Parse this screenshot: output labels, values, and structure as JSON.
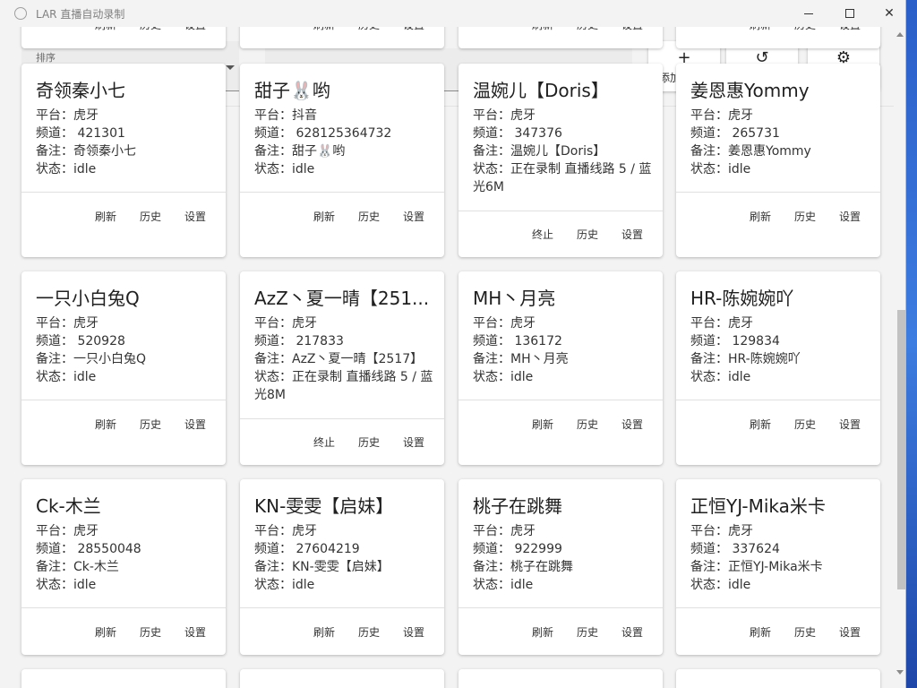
{
  "window": {
    "title": "LAR 直播自动录制"
  },
  "toolbar": {
    "sort_label": "排序",
    "add_glyph": "+",
    "add_label": "添加",
    "history_glyph": "↺",
    "settings_glyph": "⚙"
  },
  "labels": {
    "refresh": "刷新",
    "history": "历史",
    "settings": "设置",
    "stop": "终止"
  },
  "cards": [
    {
      "title": "奇领秦小七",
      "platform": "平台：虎牙",
      "channel": "频道：  421301",
      "note": "备注：奇领秦小七",
      "status": "状态：idle",
      "actions": [
        "刷新",
        "历史",
        "设置"
      ]
    },
    {
      "title": "甜子🐰哟",
      "platform": "平台：抖音",
      "channel": "频道：  628125364732",
      "note": "备注：甜子🐰哟",
      "status": "状态：idle",
      "actions": [
        "刷新",
        "历史",
        "设置"
      ]
    },
    {
      "title": "温婉儿【Doris】",
      "platform": "平台：虎牙",
      "channel": "频道：  347376",
      "note": "备注：温婉儿【Doris】",
      "status": "状态：正在录制 直播线路 5 / 蓝光6M",
      "actions": [
        "终止",
        "历史",
        "设置"
      ]
    },
    {
      "title": "姜恩惠Yommy",
      "platform": "平台：虎牙",
      "channel": "频道：  265731",
      "note": "备注：姜恩惠Yommy",
      "status": "状态：idle",
      "actions": [
        "刷新",
        "历史",
        "设置"
      ]
    },
    {
      "title": "一只小白兔Q",
      "platform": "平台：虎牙",
      "channel": "频道：  520928",
      "note": "备注：一只小白兔Q",
      "status": "状态：idle",
      "actions": [
        "刷新",
        "历史",
        "设置"
      ]
    },
    {
      "title": "AzZ丶夏一晴【251...",
      "platform": "平台：虎牙",
      "channel": "频道：  217833",
      "note": "备注：AzZ丶夏一晴【2517】",
      "status": "状态：正在录制 直播线路 5 / 蓝光8M",
      "actions": [
        "终止",
        "历史",
        "设置"
      ]
    },
    {
      "title": "MH丶月亮",
      "platform": "平台：虎牙",
      "channel": "频道：  136172",
      "note": "备注：MH丶月亮",
      "status": "状态：idle",
      "actions": [
        "刷新",
        "历史",
        "设置"
      ]
    },
    {
      "title": "HR-陈婉婉吖",
      "platform": "平台：虎牙",
      "channel": "频道：  129834",
      "note": "备注：HR-陈婉婉吖",
      "status": "状态：idle",
      "actions": [
        "刷新",
        "历史",
        "设置"
      ]
    },
    {
      "title": "Ck-木兰",
      "platform": "平台：虎牙",
      "channel": "频道：  28550048",
      "note": "备注：Ck-木兰",
      "status": "状态：idle",
      "actions": [
        "刷新",
        "历史",
        "设置"
      ]
    },
    {
      "title": "KN-雯雯【启妹】",
      "platform": "平台：虎牙",
      "channel": "频道：  27604219",
      "note": "备注：KN-雯雯【启妹】",
      "status": "状态：idle",
      "actions": [
        "刷新",
        "历史",
        "设置"
      ]
    },
    {
      "title": "桃子在跳舞",
      "platform": "平台：虎牙",
      "channel": "频道：  922999",
      "note": "备注：桃子在跳舞",
      "status": "状态：idle",
      "actions": [
        "刷新",
        "历史",
        "设置"
      ]
    },
    {
      "title": "正恒YJ-Mika米卡",
      "platform": "平台：虎牙",
      "channel": "频道：  337624",
      "note": "备注：正恒YJ-Mika米卡",
      "status": "状态：idle",
      "actions": [
        "刷新",
        "历史",
        "设置"
      ]
    }
  ]
}
